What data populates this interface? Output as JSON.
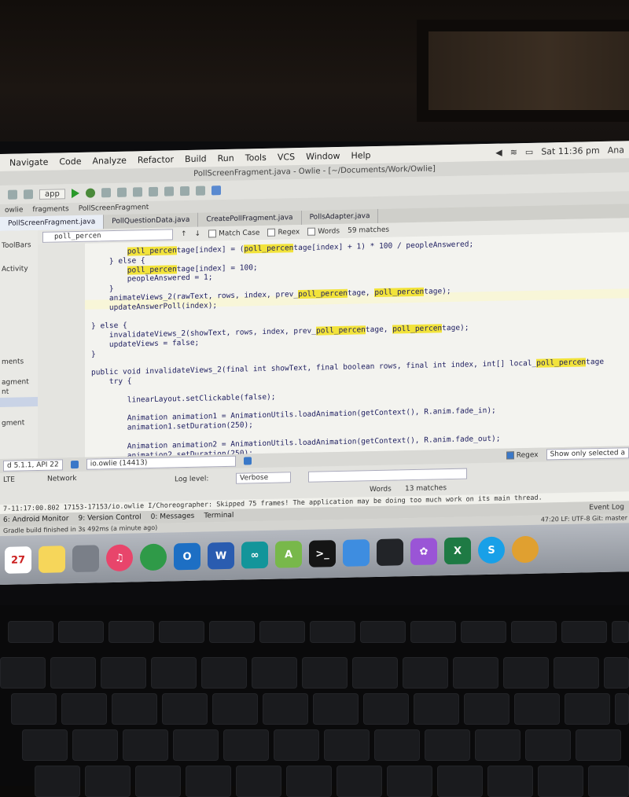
{
  "menubar": {
    "items": [
      "Navigate",
      "Code",
      "Analyze",
      "Refactor",
      "Build",
      "Run",
      "Tools",
      "VCS",
      "Window",
      "Help"
    ],
    "clock": "Sat 11:36 pm",
    "user": "Ana"
  },
  "window_title": "PollScreenFragment.java - Owlie - [~/Documents/Work/Owlie]",
  "toolbar": {
    "module": "app"
  },
  "breadcrumbs": [
    "owlie",
    "fragments",
    "PollScreenFragment"
  ],
  "tabs": [
    "PollScreenFragment.java",
    "PollQuestionData.java",
    "CreatePollFragment.java",
    "PollsAdapter.java"
  ],
  "find": {
    "query": "poll_percen",
    "match_case_label": "Match Case",
    "regex_label": "Regex",
    "words_label": "Words",
    "result": "59 matches"
  },
  "left_panel": [
    "ToolBars",
    "Activity",
    "ments",
    "agment",
    "nt",
    "gment"
  ],
  "code": [
    "        poll_percentage[index] = (poll_percentage[index] + 1) * 100 / peopleAnswered;",
    "    } else {",
    "        poll_percentage[index] = 100;",
    "        peopleAnswered = 1;",
    "    }",
    "    animateViews_2(rawText, rows, index, prev_poll_percentage, poll_percentage);",
    "    updateAnswerPoll(index);",
    "",
    "} else {",
    "    invalidateViews_2(showText, rows, index, prev_poll_percentage, poll_percentage);",
    "    updateViews = false;",
    "}",
    "",
    "public void invalidateViews_2(final int showText, final boolean rows, final int index, int[] local_poll_percentage",
    "    try {",
    "",
    "        linearLayout.setClickable(false);",
    "",
    "        Animation animation1 = AnimationUtils.loadAnimation(getContext(), R.anim.fade_in);",
    "        animation1.setDuration(250);",
    "",
    "        Animation animation2 = AnimationUtils.loadAnimation(getContext(), R.anim.fade_out);",
    "        animation2.setDuration(250);"
  ],
  "logcat": {
    "device": "d 5.1.1, API 22",
    "process": "io.owlie (14413)",
    "log_level_label": "Log level:",
    "log_level": "Verbose",
    "regex_label": "Regex",
    "show_only": "Show only selected a",
    "filter_tag_1": "LTE",
    "filter_tag_2": "Network",
    "find_words": "Words",
    "find_result": "13 matches",
    "log_text": "I/Choreographer: Skipped 75 frames!  The application may be doing too much work on its main thread.",
    "log_prefix": "7-11:17:00.802 17153-17153/io.owlie",
    "event_log": "Event Log"
  },
  "tool_windows": [
    "6: Android Monitor",
    "9: Version Control",
    "0: Messages",
    "Terminal"
  ],
  "status_line": "Gradle build finished in 3s 492ms (a minute ago)",
  "cursor_info": "47:20   LF:   UTF-8   Git: master",
  "dock": [
    {
      "name": "calendar",
      "label": "27",
      "color": "#ffffff"
    },
    {
      "name": "notes",
      "label": "",
      "color": "#f6d65a"
    },
    {
      "name": "preferences",
      "label": "",
      "color": "#7a7f88"
    },
    {
      "name": "itunes",
      "label": "♫",
      "color": "#e8456b"
    },
    {
      "name": "chrome",
      "label": "",
      "color": "#2f9a48"
    },
    {
      "name": "outlook",
      "label": "O",
      "color": "#1d6fc4"
    },
    {
      "name": "word",
      "label": "W",
      "color": "#2a5cb0"
    },
    {
      "name": "arduino",
      "label": "∞",
      "color": "#13959a"
    },
    {
      "name": "android-studio",
      "label": "A",
      "color": "#78b84a"
    },
    {
      "name": "terminal",
      "label": ">_",
      "color": "#151515"
    },
    {
      "name": "xcode",
      "label": "",
      "color": "#3e8de0"
    },
    {
      "name": "app-dark",
      "label": "",
      "color": "#222428"
    },
    {
      "name": "flower",
      "label": "✿",
      "color": "#9a55d6"
    },
    {
      "name": "excel",
      "label": "X",
      "color": "#1e7a44"
    },
    {
      "name": "skype",
      "label": "S",
      "color": "#18a0e8"
    },
    {
      "name": "paint",
      "label": "",
      "color": "#e0a030"
    }
  ]
}
